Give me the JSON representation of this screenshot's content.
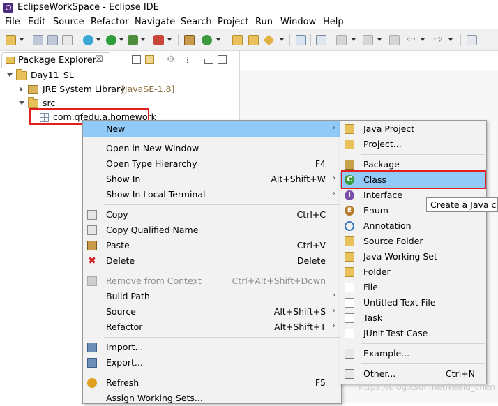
{
  "window": {
    "title": "EclipseWorkSpace - Eclipse IDE"
  },
  "menubar": [
    "File",
    "Edit",
    "Source",
    "Refactor",
    "Navigate",
    "Search",
    "Project",
    "Run",
    "Window",
    "Help"
  ],
  "view": {
    "tab_label": "Package Explorer",
    "close_glyph": "☒"
  },
  "tree": {
    "project": "Day11_SL",
    "library": "JRE System Library",
    "library_suffix": "[JavaSE-1.8]",
    "src": "src",
    "package": "com.qfedu.a.homework"
  },
  "context_menu": {
    "new": "New",
    "open_new_window": "Open in New Window",
    "open_type_hierarchy": "Open Type Hierarchy",
    "open_type_hierarchy_key": "F4",
    "show_in": "Show In",
    "show_in_key": "Alt+Shift+W",
    "show_local_terminal": "Show In Local Terminal",
    "copy": "Copy",
    "copy_key": "Ctrl+C",
    "copy_qualified": "Copy Qualified Name",
    "paste": "Paste",
    "paste_key": "Ctrl+V",
    "delete": "Delete",
    "delete_key": "Delete",
    "remove_context": "Remove from Context",
    "remove_context_key": "Ctrl+Alt+Shift+Down",
    "build_path": "Build Path",
    "source": "Source",
    "source_key": "Alt+Shift+S",
    "refactor": "Refactor",
    "refactor_key": "Alt+Shift+T",
    "import": "Import...",
    "export": "Export...",
    "refresh": "Refresh",
    "refresh_key": "F5",
    "assign_working_sets": "Assign Working Sets..."
  },
  "submenu": {
    "java_project": "Java Project",
    "project": "Project...",
    "package": "Package",
    "class": "Class",
    "interface": "Interface",
    "enum": "Enum",
    "annotation": "Annotation",
    "source_folder": "Source Folder",
    "java_working_set": "Java Working Set",
    "folder": "Folder",
    "file": "File",
    "untitled_text_file": "Untitled Text File",
    "task": "Task",
    "junit_test_case": "JUnit Test Case",
    "example": "Example...",
    "other": "Other...",
    "other_key": "Ctrl+N"
  },
  "tooltip": "Create a Java cla",
  "watermark": "https://blog.csdn.net/keaid_chen",
  "colors": {
    "selection": "#91c9f7",
    "highlight_box": "#e02020",
    "menu_bg": "#f2f2f2"
  },
  "icons": {
    "app": "eclipse-icon",
    "copy": "copy-icon",
    "paste": "paste-icon",
    "delete": "delete-icon",
    "class": "class-icon",
    "interface": "interface-icon",
    "enum": "enum-icon",
    "annotation": "annotation-icon"
  }
}
